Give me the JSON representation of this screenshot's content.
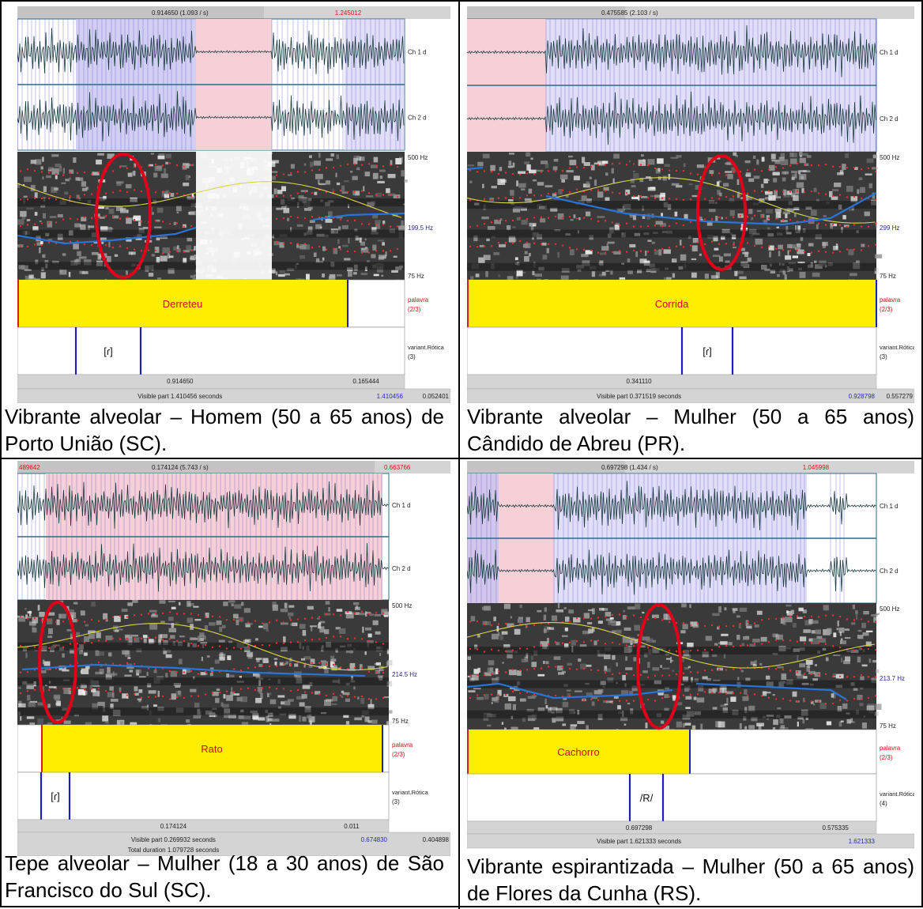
{
  "panels": [
    {
      "top_left": "0.914650 (1.093 / s)",
      "top_right_red": "1.245012",
      "top_left_red": "",
      "ch1": "Ch 1 d",
      "ch2": "Ch 2 d",
      "spec_top": "500 Hz",
      "spec_mid": "199.5 Hz",
      "spec_bottom": "75 Hz",
      "word": "Derreteu",
      "tier1_name": "palavra",
      "tier1_count": "(2/3)",
      "segment": "[ɾ]",
      "tier2_name": "variant.Rótica",
      "tier2_count": "(3)",
      "bottom_left": "0.914650",
      "bottom_right": "0.165444",
      "visible": "Visible part 1.410456 seconds",
      "visible_right": "1.410456",
      "visible_far": "0.052401",
      "total": "",
      "caption": "Vibrante alveolar – Homem (50 a 65 anos) de Porto União (SC)."
    },
    {
      "top_left": "0.475585 (2.103 / s)",
      "top_right_red": "",
      "top_left_red": "",
      "ch1": "Ch 1 d",
      "ch2": "Ch 2 d",
      "spec_top": "500 Hz",
      "spec_mid": "299 Hz",
      "spec_bottom": "75 Hz",
      "word": "Corrida",
      "tier1_name": "palavra",
      "tier1_count": "(2/3)",
      "segment": "[ɾ]",
      "tier2_name": "variant.Rótica",
      "tier2_count": "(3)",
      "bottom_left": "0.341110",
      "bottom_right": "",
      "visible": "Visible part 0.371519 seconds",
      "visible_right": "0.928798",
      "visible_far": "0.557279",
      "total": "",
      "caption": "Vibrante alveolar – Mulher (50 a 65 anos) Cândido de Abreu (PR)."
    },
    {
      "top_left": "0.174124 (5.743 / s)",
      "top_right_red": "0.663766",
      "top_left_red": "489642",
      "ch1": "Ch 1 d",
      "ch2": "Ch 2 d",
      "spec_top": "500 Hz",
      "spec_mid": "214.5 Hz",
      "spec_bottom": "75 Hz",
      "word": "Rato",
      "tier1_name": "palavra",
      "tier1_count": "(2/3)",
      "segment": "[ɾ]",
      "tier2_name": "variant.Rótica",
      "tier2_count": "(3)",
      "bottom_left": "0.174124",
      "bottom_right": "0.011",
      "visible": "Visible part 0.269932 seconds",
      "visible_right": "0.674830",
      "visible_far": "0.404898",
      "total": "Total duration 1.079728 seconds",
      "caption": "Tepe alveolar – Mulher (18 a 30 anos) de São Francisco do Sul (SC)."
    },
    {
      "top_left": "0.697298 (1.434 / s)",
      "top_right_red": "1.045998",
      "top_left_red": "",
      "ch1": "Ch 1 d",
      "ch2": "Ch 2 d",
      "spec_top": "500 Hz",
      "spec_mid": "213.7 Hz",
      "spec_bottom": "75 Hz",
      "word": "Cachorro",
      "tier1_name": "palavra",
      "tier1_count": "(2/3)",
      "segment": "/R/",
      "tier2_name": "variant.Rótica",
      "tier2_count": "(4)",
      "bottom_left": "0.697298",
      "bottom_right": "0.575335",
      "visible": "Visible part 1.621333 seconds",
      "visible_right": "1.621333",
      "visible_far": "",
      "total": "",
      "caption": "Vibrante espirantizada – Mulher (50 a 65 anos) de Flores da Cunha (RS)."
    }
  ],
  "colors": {
    "pink": "#f7cfd6",
    "lavender": "#c8c3f0",
    "yellow": "#ffee00",
    "boundary": "#1f1fb8",
    "circle": "#e1001a",
    "pitch": "#2874d8",
    "intensity": "#dcd44a",
    "formant": "#ff2b2b",
    "bar": "#d4d4d4"
  }
}
